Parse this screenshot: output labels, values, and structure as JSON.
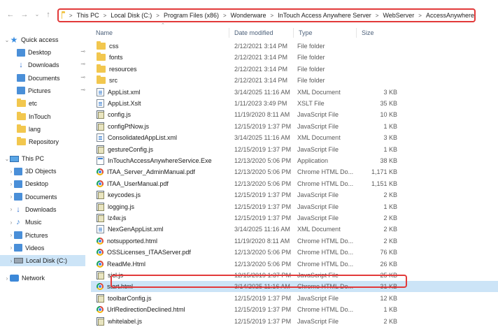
{
  "nav": {
    "back_icon": "back-arrow-icon",
    "forward_icon": "forward-arrow-icon",
    "recent_icon": "chevron-down-icon",
    "up_icon": "up-arrow-icon"
  },
  "address": {
    "crumbs": [
      "This PC",
      "Local Disk (C:)",
      "Program Files (x86)",
      "Wonderware",
      "InTouch Access Anywhere Server",
      "WebServer",
      "AccessAnywhere"
    ]
  },
  "sidebar": {
    "quick_access": "Quick access",
    "quick_items": [
      {
        "label": "Desktop",
        "icon": "desktop-icon",
        "pinned": true
      },
      {
        "label": "Downloads",
        "icon": "download-icon",
        "pinned": true
      },
      {
        "label": "Documents",
        "icon": "documents-icon",
        "pinned": true
      },
      {
        "label": "Pictures",
        "icon": "pictures-icon",
        "pinned": true
      },
      {
        "label": "etc",
        "icon": "folder-icon",
        "pinned": false
      },
      {
        "label": "InTouch",
        "icon": "folder-icon",
        "pinned": false
      },
      {
        "label": "lang",
        "icon": "folder-icon",
        "pinned": false
      },
      {
        "label": "Repository",
        "icon": "folder-icon",
        "pinned": false
      }
    ],
    "this_pc": "This PC",
    "pc_items": [
      {
        "label": "3D Objects",
        "icon": "3d-objects-icon"
      },
      {
        "label": "Desktop",
        "icon": "desktop-icon"
      },
      {
        "label": "Documents",
        "icon": "documents-icon"
      },
      {
        "label": "Downloads",
        "icon": "download-icon"
      },
      {
        "label": "Music",
        "icon": "music-icon"
      },
      {
        "label": "Pictures",
        "icon": "pictures-icon"
      },
      {
        "label": "Videos",
        "icon": "videos-icon"
      },
      {
        "label": "Local Disk (C:)",
        "icon": "drive-icon"
      }
    ],
    "network": "Network"
  },
  "columns": {
    "name": "Name",
    "date": "Date modified",
    "type": "Type",
    "size": "Size"
  },
  "files": [
    {
      "name": "css",
      "date": "2/12/2021 3:14 PM",
      "type": "File folder",
      "size": "",
      "icon": "folder"
    },
    {
      "name": "fonts",
      "date": "2/12/2021 3:14 PM",
      "type": "File folder",
      "size": "",
      "icon": "folder"
    },
    {
      "name": "resources",
      "date": "2/12/2021 3:14 PM",
      "type": "File folder",
      "size": "",
      "icon": "folder"
    },
    {
      "name": "src",
      "date": "2/12/2021 3:14 PM",
      "type": "File folder",
      "size": "",
      "icon": "folder"
    },
    {
      "name": "AppList.xml",
      "date": "3/14/2025 11:16 AM",
      "type": "XML Document",
      "size": "3 KB",
      "icon": "xml"
    },
    {
      "name": "AppList.Xslt",
      "date": "1/11/2023 3:49 PM",
      "type": "XSLT File",
      "size": "35 KB",
      "icon": "xml"
    },
    {
      "name": "config.js",
      "date": "11/19/2020 8:11 AM",
      "type": "JavaScript File",
      "size": "10 KB",
      "icon": "js"
    },
    {
      "name": "configPtNow.js",
      "date": "12/15/2019 1:37 PM",
      "type": "JavaScript File",
      "size": "1 KB",
      "icon": "js"
    },
    {
      "name": "ConsolidatedAppList.xml",
      "date": "3/14/2025 11:16 AM",
      "type": "XML Document",
      "size": "3 KB",
      "icon": "xml"
    },
    {
      "name": "gestureConfig.js",
      "date": "12/15/2019 1:37 PM",
      "type": "JavaScript File",
      "size": "1 KB",
      "icon": "js"
    },
    {
      "name": "InTouchAccessAnywhereService.Exe",
      "date": "12/13/2020 5:06 PM",
      "type": "Application",
      "size": "38 KB",
      "icon": "exe"
    },
    {
      "name": "ITAA_Server_AdminManual.pdf",
      "date": "12/13/2020 5:06 PM",
      "type": "Chrome HTML Do...",
      "size": "1,171 KB",
      "icon": "chrome"
    },
    {
      "name": "ITAA_UserManual.pdf",
      "date": "12/13/2020 5:06 PM",
      "type": "Chrome HTML Do...",
      "size": "1,151 KB",
      "icon": "chrome"
    },
    {
      "name": "keycodes.js",
      "date": "12/15/2019 1:37 PM",
      "type": "JavaScript File",
      "size": "2 KB",
      "icon": "js"
    },
    {
      "name": "logging.js",
      "date": "12/15/2019 1:37 PM",
      "type": "JavaScript File",
      "size": "1 KB",
      "icon": "js"
    },
    {
      "name": "lz4w.js",
      "date": "12/15/2019 1:37 PM",
      "type": "JavaScript File",
      "size": "2 KB",
      "icon": "js"
    },
    {
      "name": "NexGenAppList.xml",
      "date": "3/14/2025 11:16 AM",
      "type": "XML Document",
      "size": "2 KB",
      "icon": "xml"
    },
    {
      "name": "notsupported.html",
      "date": "11/19/2020 8:11 AM",
      "type": "Chrome HTML Do...",
      "size": "2 KB",
      "icon": "chrome"
    },
    {
      "name": "OSSLicenses_ITAAServer.pdf",
      "date": "12/13/2020 5:06 PM",
      "type": "Chrome HTML Do...",
      "size": "76 KB",
      "icon": "chrome"
    },
    {
      "name": "ReadMe.Html",
      "date": "12/13/2020 5:06 PM",
      "type": "Chrome HTML Do...",
      "size": "26 KB",
      "icon": "chrome"
    },
    {
      "name": "sjcl.js",
      "date": "12/15/2019 1:37 PM",
      "type": "JavaScript File",
      "size": "25 KB",
      "icon": "js"
    },
    {
      "name": "start.html",
      "date": "3/14/2025 11:16 AM",
      "type": "Chrome HTML Do...",
      "size": "31 KB",
      "icon": "chrome",
      "selected": true
    },
    {
      "name": "toolbarConfig.js",
      "date": "12/15/2019 1:37 PM",
      "type": "JavaScript File",
      "size": "12 KB",
      "icon": "js"
    },
    {
      "name": "UrlRedirectionDeclined.html",
      "date": "12/15/2019 1:37 PM",
      "type": "Chrome HTML Do...",
      "size": "1 KB",
      "icon": "chrome"
    },
    {
      "name": "whitelabel.js",
      "date": "12/15/2019 1:37 PM",
      "type": "JavaScript File",
      "size": "2 KB",
      "icon": "js"
    }
  ],
  "colors": {
    "highlight_border": "#e23a3a",
    "selection": "#cce4f7",
    "folder": "#f2c74e"
  }
}
